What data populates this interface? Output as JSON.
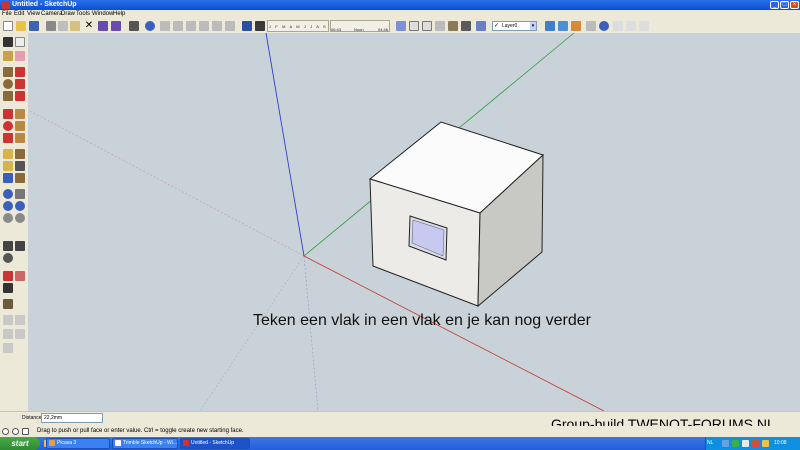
{
  "window": {
    "title": "Untitled - SketchUp",
    "minimize_glyph": "_",
    "maximize_glyph": "□",
    "close_glyph": "×"
  },
  "menu": {
    "file": "File",
    "edit": "Edit",
    "view": "View",
    "camera": "Camera",
    "draw": "Draw",
    "tools": "Tools",
    "window": "Window",
    "help": "Help"
  },
  "toolbar": {
    "shadow_months": "J F M A M J J A S O N D",
    "time_start": "06:43",
    "time_noon": "Noon",
    "time_end": "04:46",
    "layer_check": "✓",
    "layer_value": "Layer0",
    "layer_arrow": "▾"
  },
  "viewport": {
    "caption": "Teken een vlak in een vlak en je kan nog verder",
    "background": "#c9d2d8"
  },
  "measurements": {
    "label": "Distance",
    "value": "22,2mm"
  },
  "status": {
    "text": "Drag to push or pull face or enter value.  Ctrl = toggle create new starting face."
  },
  "watermark": "Group-build TWENOT-FORUMS.NL",
  "taskbar": {
    "start": "start",
    "tasks": [
      "Picasa 3",
      "Trimble SketchUp - Wi...",
      "Untitled - SketchUp"
    ],
    "language": "NL",
    "clock": "10:08"
  },
  "colors": {
    "axis_red": "#c0392b",
    "axis_green": "#2e9e3e",
    "axis_blue": "#2f3fd0",
    "titlebar": "#0a4fd2",
    "taskbar": "#245edc",
    "start_button": "#2e8b32"
  }
}
